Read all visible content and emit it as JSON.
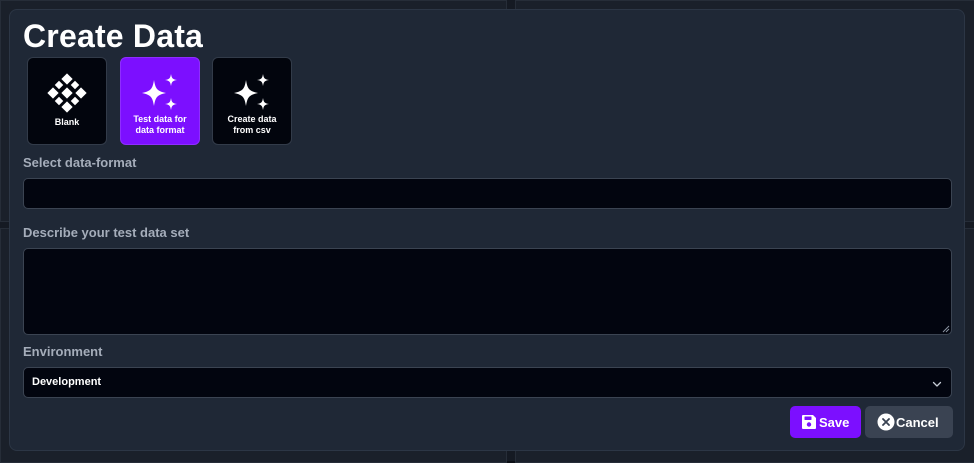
{
  "modal": {
    "title": "Create Data",
    "tiles": [
      {
        "label": "Blank",
        "icon": "blocks-icon",
        "active": false
      },
      {
        "label": "Test data for\ndata format",
        "icon": "sparkles-icon",
        "active": true
      },
      {
        "label": "Create data\nfrom csv",
        "icon": "sparkles-icon",
        "active": false
      }
    ],
    "data_format": {
      "label": "Select data-format",
      "value": ""
    },
    "description": {
      "label": "Describe your test data set",
      "value": ""
    },
    "environment": {
      "label": "Environment",
      "selected": "Development"
    },
    "buttons": {
      "save": "Save",
      "cancel": "Cancel"
    }
  },
  "colors": {
    "accent": "#7c0fff",
    "modal_bg": "#1f2836",
    "input_bg": "#02050f",
    "cancel_bg": "#3a4352"
  }
}
